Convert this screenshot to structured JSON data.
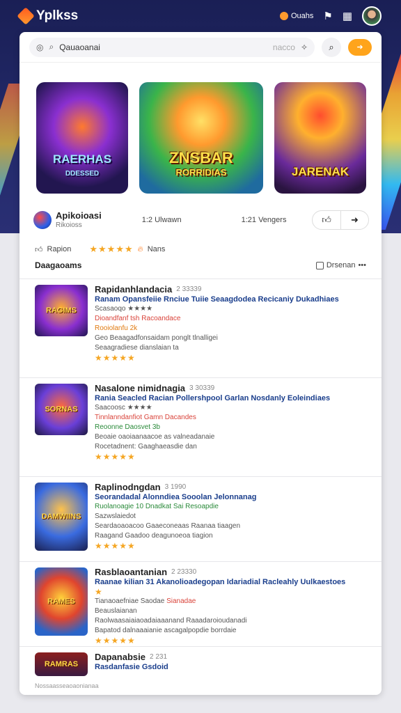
{
  "header": {
    "logo": "Yplkss",
    "coins": "Ouahs",
    "icons": [
      "flag-icon",
      "grid-icon"
    ]
  },
  "search": {
    "value": "Qauaoanai",
    "placeholder": "nacco"
  },
  "hero": {
    "cards": [
      {
        "title": "RAERHAS",
        "subtitle": "DDESSED"
      },
      {
        "title": "ZNSBAR",
        "subtitle": "RORRIDIAS"
      },
      {
        "title": "JARENAK",
        "subtitle": ""
      }
    ]
  },
  "app": {
    "name": "Apikoioasi",
    "sub": "Rikoioss",
    "stat1": "1:2 Ulwawn",
    "stat2": "1:21 Vengers"
  },
  "rating": {
    "label": "Rapion",
    "stars": "★★★★★",
    "tag": "Nans"
  },
  "section": {
    "title": "Daagaoams",
    "right": "Drsenan",
    "more": "•••"
  },
  "list": [
    {
      "thumb": "RAGIMS",
      "title": "Rapidanhlandacia",
      "badge": "2 33339",
      "line1": "Ranam Opansfeiie Rnciue Tuiie Seaagdodea Recicaniy Dukadhiaes",
      "line2": "Scasaoqo ★★★★",
      "line3": "Dioandfanf tsh",
      "line3b": "Racoandace",
      "line4": "Rooiolanfu 2k",
      "line5": "Geo Beaagadfonsaidam ponglt tlnalligei",
      "line6": "Seaagradiese dianslaian ta",
      "stars": "★★★★★"
    },
    {
      "thumb": "SORNAS",
      "title": "Nasalone nimidnagia",
      "badge": "3 30339",
      "line1": "Rania Seacled Racian Pollershpool Garlan Nosdanly Eoleindiaes",
      "line2": "Saacoosc ★★★★",
      "line3": "Tinnlanndanfiot",
      "line3b": "Gamn Dacandes",
      "line4": "Reoonne Daosvet 3b",
      "line5": "Beoaie oaoiaanaacoe as valneadanaie",
      "line6": "Rocetadnent: Gaaghaeasdie dan",
      "stars": "★★★★★"
    },
    {
      "thumb": "DAMWIINS",
      "title": "Raplinodngdan",
      "badge": "3 1990",
      "line1": "Seorandadal Alonndiea Sooolan Jelonnanag",
      "line2": "Ruolanoagie 10 Dnadkat",
      "line3": "Sai Resoapdie",
      "line4": "Sazwslaiedot",
      "line5": "Seardaoaoacoo Gaaeconeaas Raanaa tiaagen",
      "line6": "Raagand Gaadoo deagunoeoa tiagion",
      "stars": "★★★★★"
    },
    {
      "thumb": "RAMES",
      "title": "Rasblaoantanian",
      "badge": "2 23330",
      "line1": "Raanae kilian 31 Akanolioadegopan Idariadial Racleahly Uulkaestoes",
      "line2": "★",
      "line3": "Tianaoaefniae",
      "line3b": "Saodae",
      "line3c": "Sianadae",
      "line4": "Beauslaianan",
      "line5": "Raolwaasaiaiaoadaiaaanand Raaadaroioudanadi",
      "line6": "Bapatod dalnaaaianie ascagalpopdie borrdaie",
      "stars": "★★★★★"
    },
    {
      "thumb": "RAMRAS",
      "title": "Dapanabsie",
      "badge": "2 231",
      "line1": "Rasdanfasie Gsdoid"
    }
  ],
  "footer": "Nossaasseaoaonianaa"
}
